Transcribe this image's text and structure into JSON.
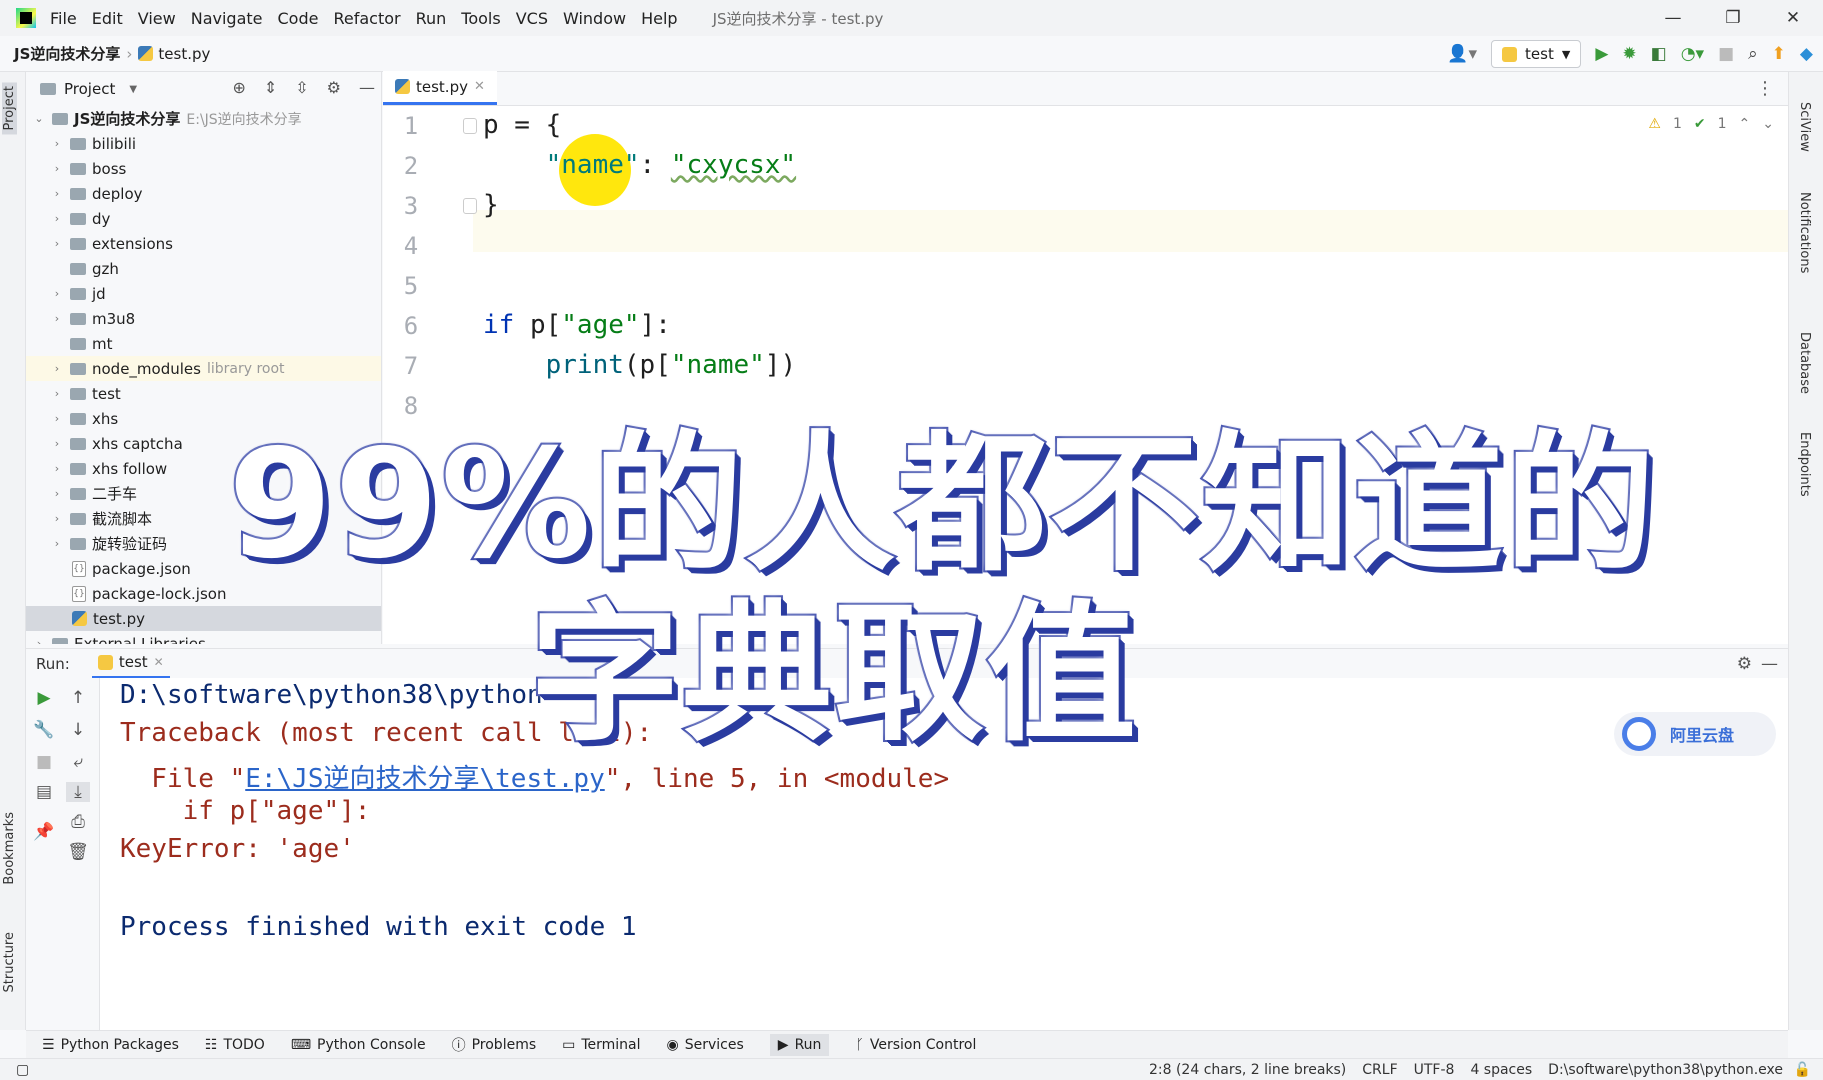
{
  "menubar": {
    "items": [
      "File",
      "Edit",
      "View",
      "Navigate",
      "Code",
      "Refactor",
      "Run",
      "Tools",
      "VCS",
      "Window",
      "Help"
    ],
    "window_title": "JS逆向技术分享 - test.py",
    "controls": [
      "—",
      "❐",
      "✕"
    ]
  },
  "navbar": {
    "project": "JS逆向技术分享",
    "file": "test.py",
    "run_config": "test"
  },
  "left_strip": {
    "tabs": [
      "Project",
      "Bookmarks",
      "Structure"
    ]
  },
  "project_panel": {
    "title": "Project",
    "root_name": "JS逆向技术分享",
    "root_path": "E:\\JS逆向技术分享",
    "items": [
      {
        "name": "bilibili",
        "hint": ""
      },
      {
        "name": "boss",
        "hint": ""
      },
      {
        "name": "deploy",
        "hint": ""
      },
      {
        "name": "dy",
        "hint": ""
      },
      {
        "name": "extensions",
        "hint": ""
      },
      {
        "name": "gzh",
        "hint": ""
      },
      {
        "name": "jd",
        "hint": ""
      },
      {
        "name": "m3u8",
        "hint": ""
      },
      {
        "name": "mt",
        "hint": ""
      },
      {
        "name": "node_modules",
        "hint": "library root"
      },
      {
        "name": "test",
        "hint": ""
      },
      {
        "name": "xhs",
        "hint": ""
      },
      {
        "name": "xhs captcha",
        "hint": ""
      },
      {
        "name": "xhs follow",
        "hint": ""
      },
      {
        "name": "二手车",
        "hint": ""
      },
      {
        "name": "截流脚本",
        "hint": ""
      },
      {
        "name": "旋转验证码",
        "hint": ""
      },
      {
        "name": "package.json",
        "hint": ""
      },
      {
        "name": "package-lock.json",
        "hint": ""
      },
      {
        "name": "test.py",
        "hint": ""
      }
    ],
    "external": "External Libraries"
  },
  "editor": {
    "tab": "test.py",
    "line_numbers": [
      "1",
      "2",
      "3",
      "4",
      "5",
      "6",
      "7",
      "8"
    ],
    "inspections": {
      "warnings": "1",
      "weak": "1"
    }
  },
  "run_panel": {
    "label": "Run:",
    "tab": "test",
    "console": {
      "line1": "D:\\software\\python38\\python",
      "line2": "Traceback (most recent call last):",
      "line3_pre": "  File \"",
      "line3_link": "E:\\JS逆向技术分享\\test.py",
      "line3_post": "\", line 5, in <module>",
      "line4": "    if p[\"age\"]:",
      "line5": "KeyError: 'age'",
      "line6": "Process finished with exit code 1"
    }
  },
  "aliyun_badge": "阿里云盘",
  "right_strip": {
    "tabs": [
      "SciView",
      "Notifications",
      "Database",
      "Endpoints"
    ]
  },
  "tool_windows": [
    "Python Packages",
    "TODO",
    "Python Console",
    "Problems",
    "Terminal",
    "Services",
    "Run",
    "Version Control"
  ],
  "statusbar": {
    "position": "2:8 (24 chars, 2 line breaks)",
    "line_sep": "CRLF",
    "encoding": "UTF-8",
    "indent": "4 spaces",
    "interpreter": "D:\\software\\python38\\python.exe"
  },
  "overlay_caption": {
    "line1": "99%的人都不知道的",
    "line2": "字典取值"
  },
  "colors": {
    "accent": "#3574f0",
    "caption_outline": "#3140a8",
    "cursor_highlight": "#ffe600"
  }
}
